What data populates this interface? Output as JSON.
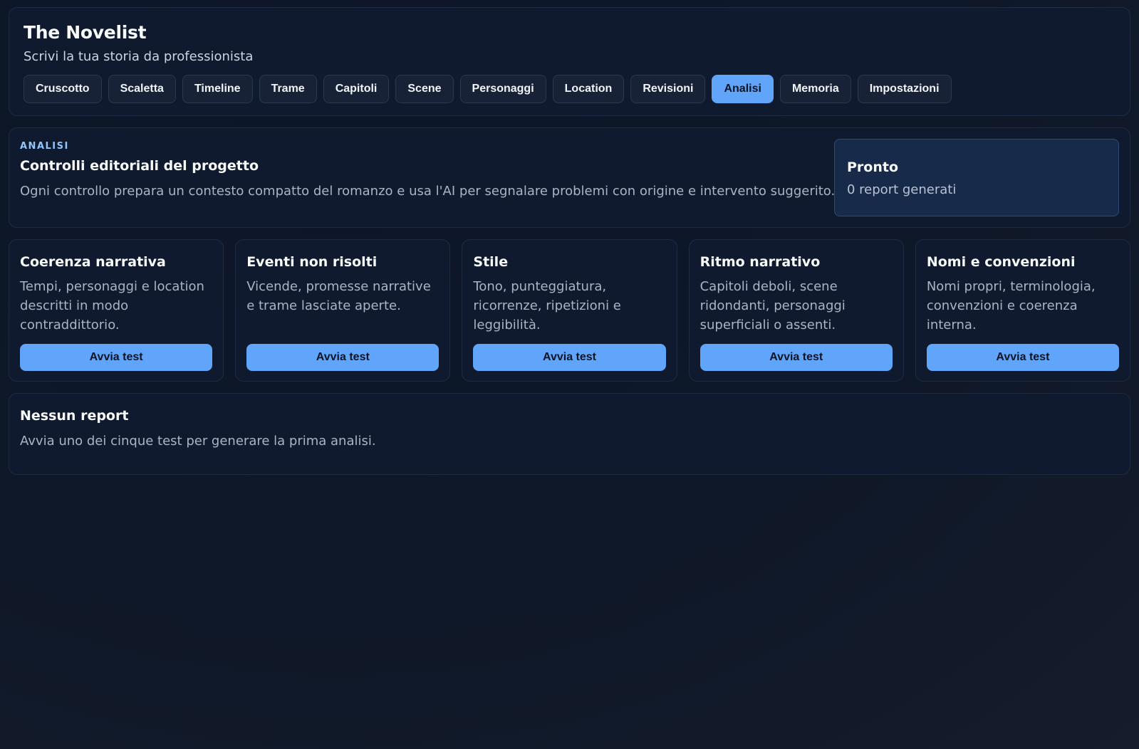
{
  "app": {
    "title": "The Novelist",
    "subtitle": "Scrivi la tua storia da professionista"
  },
  "nav": {
    "tabs": [
      {
        "label": "Cruscotto",
        "active": false
      },
      {
        "label": "Scaletta",
        "active": false
      },
      {
        "label": "Timeline",
        "active": false
      },
      {
        "label": "Trame",
        "active": false
      },
      {
        "label": "Capitoli",
        "active": false
      },
      {
        "label": "Scene",
        "active": false
      },
      {
        "label": "Personaggi",
        "active": false
      },
      {
        "label": "Location",
        "active": false
      },
      {
        "label": "Revisioni",
        "active": false
      },
      {
        "label": "Analisi",
        "active": true
      },
      {
        "label": "Memoria",
        "active": false
      },
      {
        "label": "Impostazioni",
        "active": false
      }
    ]
  },
  "intro": {
    "eyebrow": "ANALISI",
    "title": "Controlli editoriali del progetto",
    "description": "Ogni controllo prepara un contesto compatto del romanzo e usa l'AI per segnalare problemi con origine e intervento suggerito."
  },
  "status": {
    "title": "Pronto",
    "text": "0 report generati"
  },
  "tests": [
    {
      "title": "Coerenza narrativa",
      "description": "Tempi, personaggi e location descritti in modo contraddittorio.",
      "button": "Avvia test"
    },
    {
      "title": "Eventi non risolti",
      "description": "Vicende, promesse narrative e trame lasciate aperte.",
      "button": "Avvia test"
    },
    {
      "title": "Stile",
      "description": "Tono, punteggiatura, ricorrenze, ripetizioni e leggibilità.",
      "button": "Avvia test"
    },
    {
      "title": "Ritmo narrativo",
      "description": "Capitoli deboli, scene ridondanti, personaggi superficiali o assenti.",
      "button": "Avvia test"
    },
    {
      "title": "Nomi e convenzioni",
      "description": "Nomi propri, terminologia, convenzioni e coerenza interna.",
      "button": "Avvia test"
    }
  ],
  "report": {
    "title": "Nessun report",
    "text": "Avvia uno dei cinque test per generare la prima analisi."
  },
  "colors": {
    "accent": "#60a5fa",
    "background": "#0f172a",
    "panel": "#0f1a2e"
  }
}
